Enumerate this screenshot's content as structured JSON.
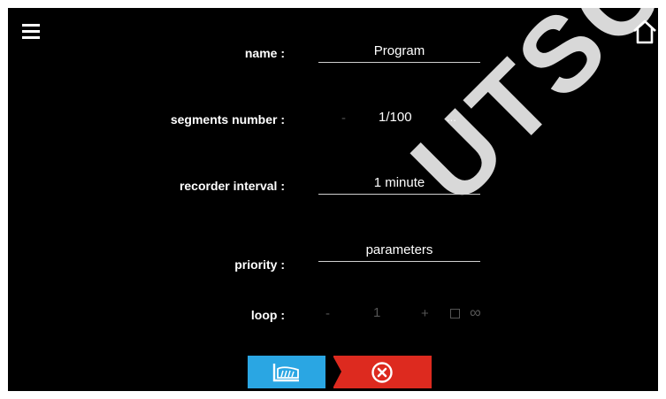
{
  "watermark": "UTSCHE",
  "icons": {
    "menu": "hamburger-menu-icon",
    "home": "home-icon",
    "chart": "chart-icon",
    "cancel": "cancel-circle-x-icon",
    "infinity": "infinity-icon",
    "checkbox": "checkbox-icon"
  },
  "colors": {
    "background": "#000000",
    "chart_button": "#2aa6e3",
    "cancel_button": "#dd2a1f",
    "disabled_text": "#555555"
  },
  "form": {
    "name": {
      "label": "name :",
      "value": "Program"
    },
    "segments": {
      "label": "segments number :",
      "minus": "-",
      "value": "1/100",
      "more": "..."
    },
    "recorder_interval": {
      "label": "recorder interval :",
      "value": "1 minute"
    },
    "priority": {
      "label": "priority :",
      "value": "parameters"
    },
    "loop": {
      "label": "loop :",
      "minus": "-",
      "value": "1",
      "plus": "+",
      "infinity": "∞"
    }
  }
}
